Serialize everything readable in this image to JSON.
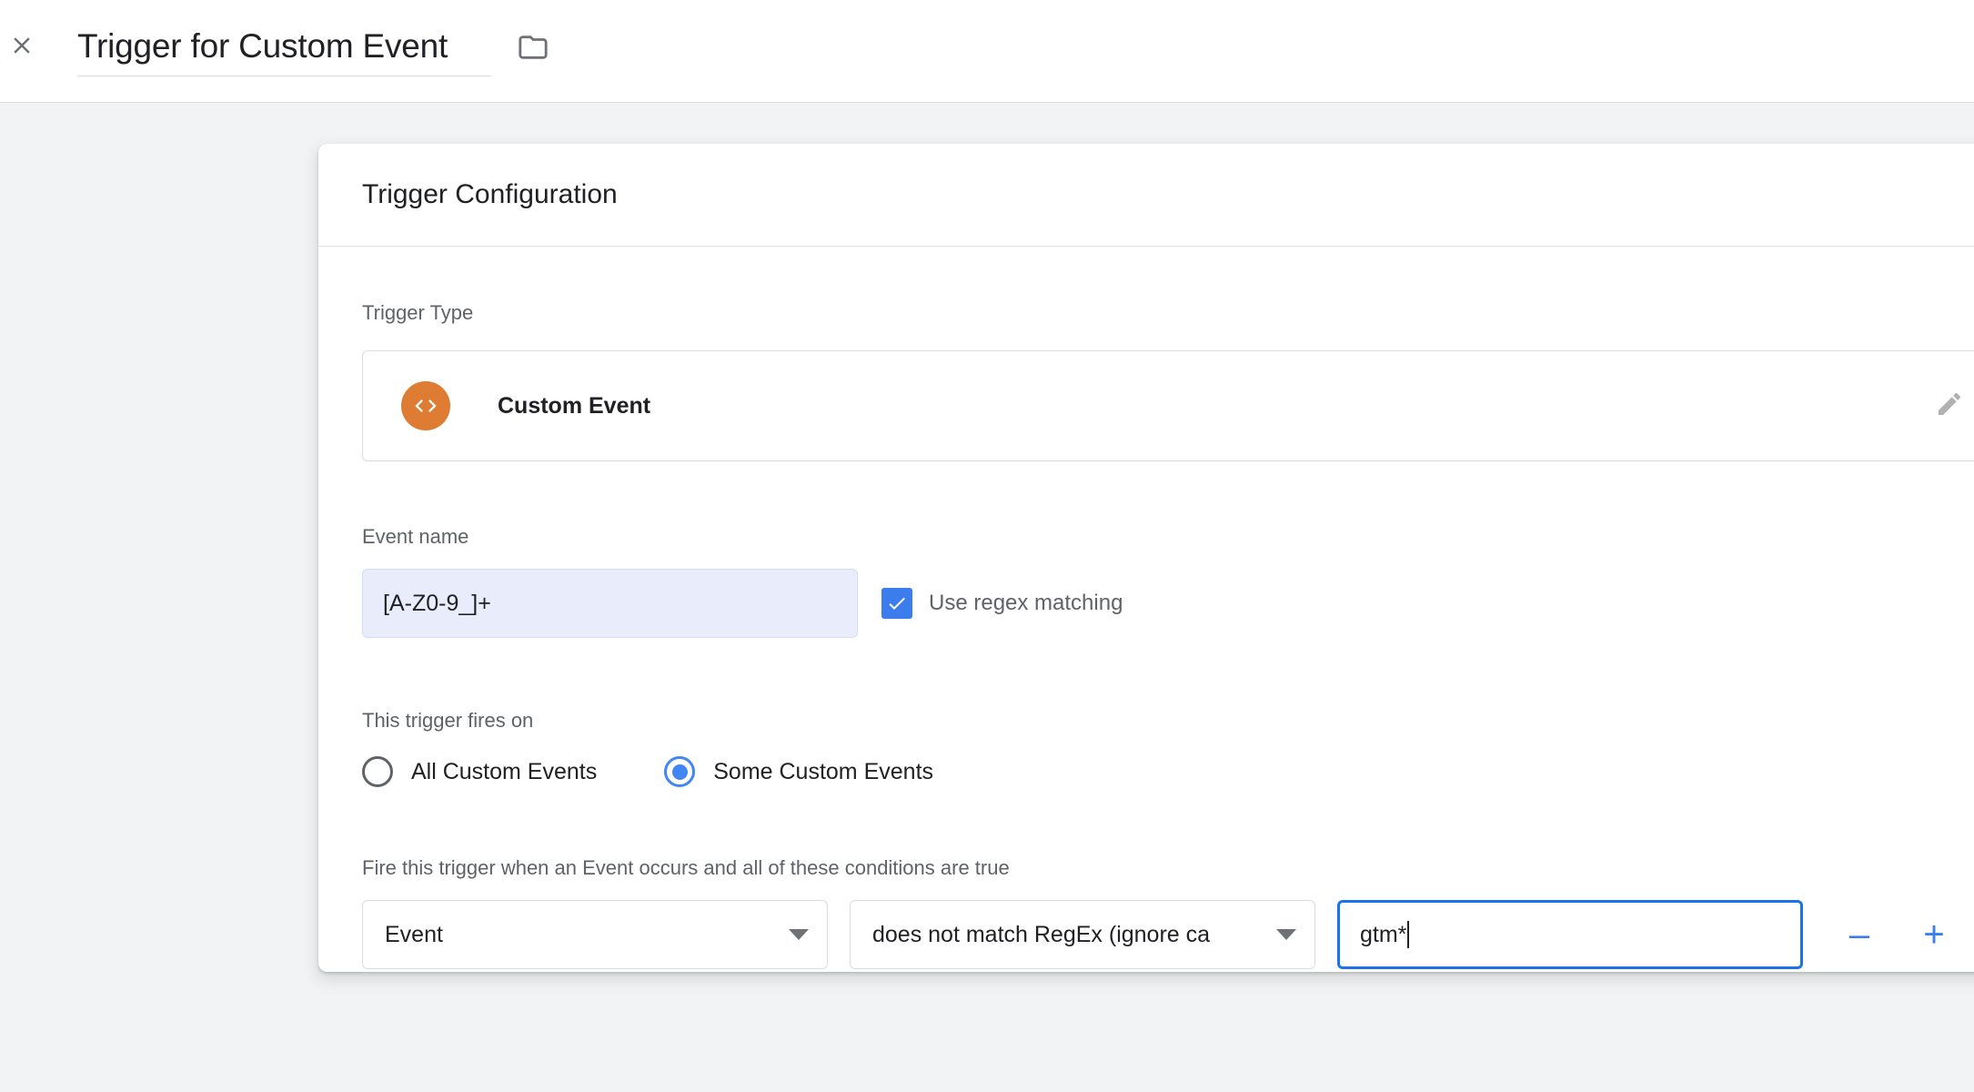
{
  "header": {
    "close_icon": "close-icon",
    "title": "Trigger for Custom Event",
    "folder_icon": "folder-icon"
  },
  "card": {
    "title": "Trigger Configuration",
    "trigger_type": {
      "label": "Trigger Type",
      "icon": "code-brackets-icon",
      "icon_color": "#dd7c32",
      "name": "Custom Event",
      "edit_icon": "pencil-icon"
    },
    "event_name": {
      "label": "Event name",
      "value": "[A-Z0-9_]+",
      "placeholder": "",
      "field_bg": "#e9edfb",
      "regex_checkbox": {
        "checked": true,
        "label": "Use regex matching",
        "color": "#3b7ded",
        "check_icon": "checkmark-icon"
      }
    },
    "fires_on": {
      "label": "This trigger fires on",
      "options": [
        {
          "label": "All Custom Events",
          "selected": false
        },
        {
          "label": "Some Custom Events",
          "selected": true
        }
      ],
      "selected_color": "#4285f4"
    },
    "conditions": {
      "label": "Fire this trigger when an Event occurs and all of these conditions are true",
      "rows": [
        {
          "variable": "Event",
          "operator": "does not match RegEx (ignore ca",
          "value": "gtm*",
          "focused": true
        }
      ],
      "remove_label": "–",
      "add_label": "+",
      "button_color": "#3b7ded"
    }
  },
  "colors": {
    "page_background": "#f1f3f4",
    "surface": "#ffffff",
    "border": "#dadce0",
    "text_primary": "#202124",
    "text_secondary": "#5f6368",
    "accent_blue": "#1a73e8",
    "accent_orange": "#dd7c32"
  }
}
